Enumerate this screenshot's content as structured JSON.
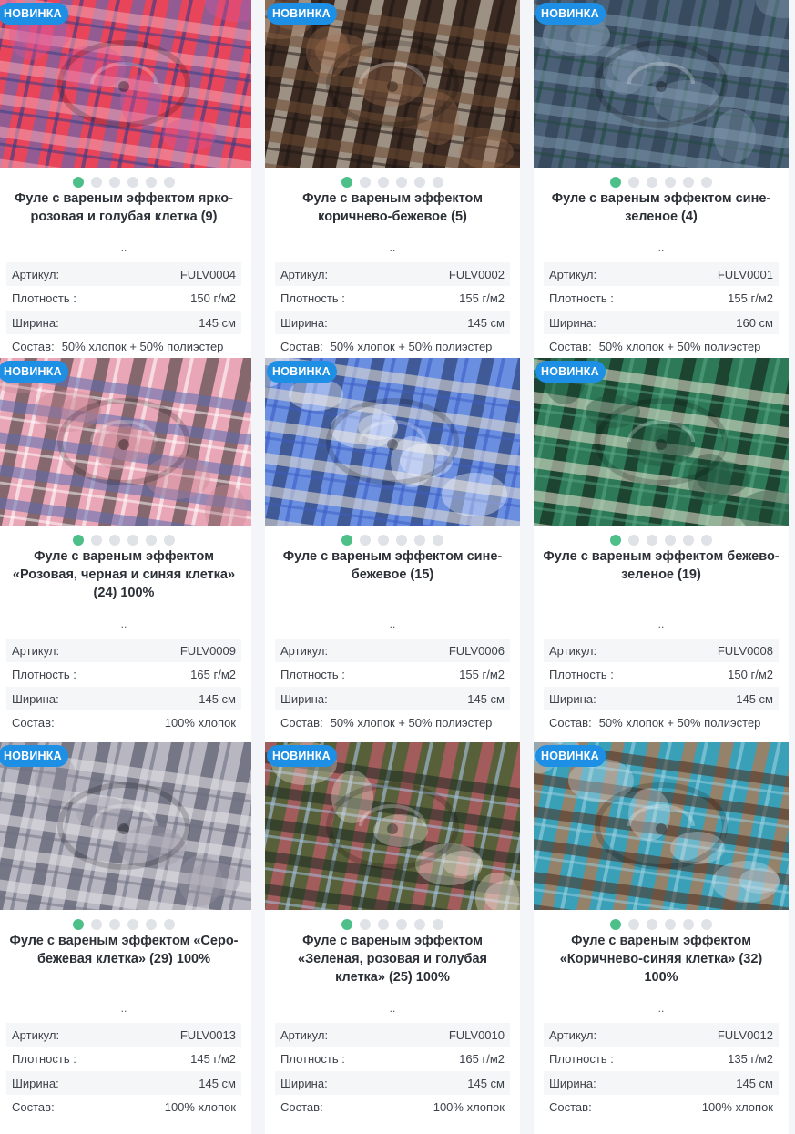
{
  "badge_label": "НОВИНКА",
  "ellipsis": "..",
  "spec_labels": {
    "article": "Артикул:",
    "density": "Плотность :",
    "width": "Ширина:",
    "composition": "Состав:"
  },
  "colors": {
    "badge": "#1d8fe5",
    "dot_active": "#4dc08a",
    "dot_inactive": "#dfe2e6"
  },
  "products": [
    {
      "title": "Фуле с вареным эффектом ярко-розовая и голубая клетка (9)",
      "article": "FULV0004",
      "density": "150 г/м2",
      "width": "145 см",
      "composition": "50% хлопок + 50% полиэстер",
      "dots": 6,
      "active_dot": 0
    },
    {
      "title": "Фуле с вареным эффектом коричнево-бежевое (5)",
      "article": "FULV0002",
      "density": "155 г/м2",
      "width": "145 см",
      "composition": "50% хлопок + 50% полиэстер",
      "dots": 6,
      "active_dot": 0
    },
    {
      "title": "Фуле с вареным эффектом сине-зеленое (4)",
      "article": "FULV0001",
      "density": "155 г/м2",
      "width": "160 см",
      "composition": "50% хлопок + 50% полиэстер",
      "dots": 6,
      "active_dot": 0
    },
    {
      "title": "Фуле с вареным эффектом «Розовая, черная и синяя клетка» (24) 100%",
      "article": "FULV0009",
      "density": "165 г/м2",
      "width": "145 см",
      "composition": "100% хлопок",
      "dots": 6,
      "active_dot": 0
    },
    {
      "title": "Фуле с вареным эффектом сине-бежевое (15)",
      "article": "FULV0006",
      "density": "155 г/м2",
      "width": "145 см",
      "composition": "50% хлопок + 50% полиэстер",
      "dots": 6,
      "active_dot": 0
    },
    {
      "title": "Фуле с вареным эффектом бежево-зеленое (19)",
      "article": "FULV0008",
      "density": "150 г/м2",
      "width": "145 см",
      "composition": "50% хлопок + 50% полиэстер",
      "dots": 6,
      "active_dot": 0
    },
    {
      "title": "Фуле с вареным эффектом «Серо-бежевая клетка» (29) 100%",
      "article": "FULV0013",
      "density": "145 г/м2",
      "width": "145 см",
      "composition": "100% хлопок",
      "dots": 6,
      "active_dot": 0
    },
    {
      "title": "Фуле с вареным эффектом «Зеленая, розовая и голубая клетка» (25) 100%",
      "article": "FULV0010",
      "density": "165 г/м2",
      "width": "145 см",
      "composition": "100% хлопок",
      "dots": 6,
      "active_dot": 0
    },
    {
      "title": "Фуле с вареным эффектом «Коричнево-синяя клетка» (32) 100%",
      "article": "FULV0012",
      "density": "135 г/м2",
      "width": "145 см",
      "composition": "100% хлопок",
      "dots": 6,
      "active_dot": 0
    }
  ]
}
